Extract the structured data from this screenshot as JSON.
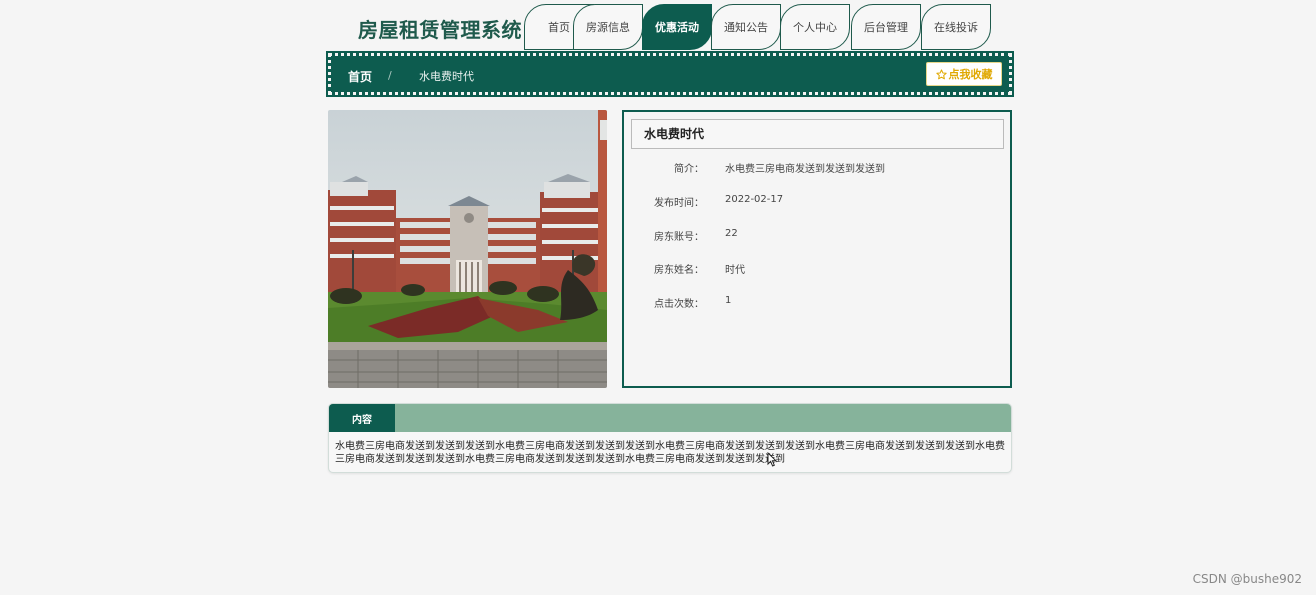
{
  "site": {
    "title": "房屋租赁管理系统"
  },
  "nav": [
    {
      "label": "首页",
      "active": false
    },
    {
      "label": "房源信息",
      "active": false
    },
    {
      "label": "优惠活动",
      "active": true
    },
    {
      "label": "通知公告",
      "active": false
    },
    {
      "label": "个人中心",
      "active": false
    },
    {
      "label": "后台管理",
      "active": false
    },
    {
      "label": "在线投诉",
      "active": false
    }
  ],
  "breadcrumb": {
    "home": "首页",
    "separator": "/",
    "current": "水电费时代"
  },
  "favorite_button": {
    "icon": "star-icon",
    "label": "点我收藏"
  },
  "detail": {
    "title": "水电费时代",
    "rows": [
      {
        "label": "简介：",
        "value": "水电费三房电商发送到发送到发送到"
      },
      {
        "label": "发布时间：",
        "value": "2022-02-17"
      },
      {
        "label": "房东账号：",
        "value": "22"
      },
      {
        "label": "房东姓名：",
        "value": "时代"
      },
      {
        "label": "点击次数：",
        "value": "1"
      }
    ]
  },
  "content": {
    "tab_label": "内容",
    "text": "水电费三房电商发送到发送到发送到水电费三房电商发送到发送到发送到水电费三房电商发送到发送到发送到水电费三房电商发送到发送到发送到水电费三房电商发送到发送到发送到水电费三房电商发送到发送到发送到水电费三房电商发送到发送到发送到"
  },
  "watermark": "CSDN @bushe902",
  "colors": {
    "primary": "#0d5c4f",
    "tab_strip": "#86b39b",
    "favorite": "#e0a800",
    "background": "#f5f5f5"
  }
}
